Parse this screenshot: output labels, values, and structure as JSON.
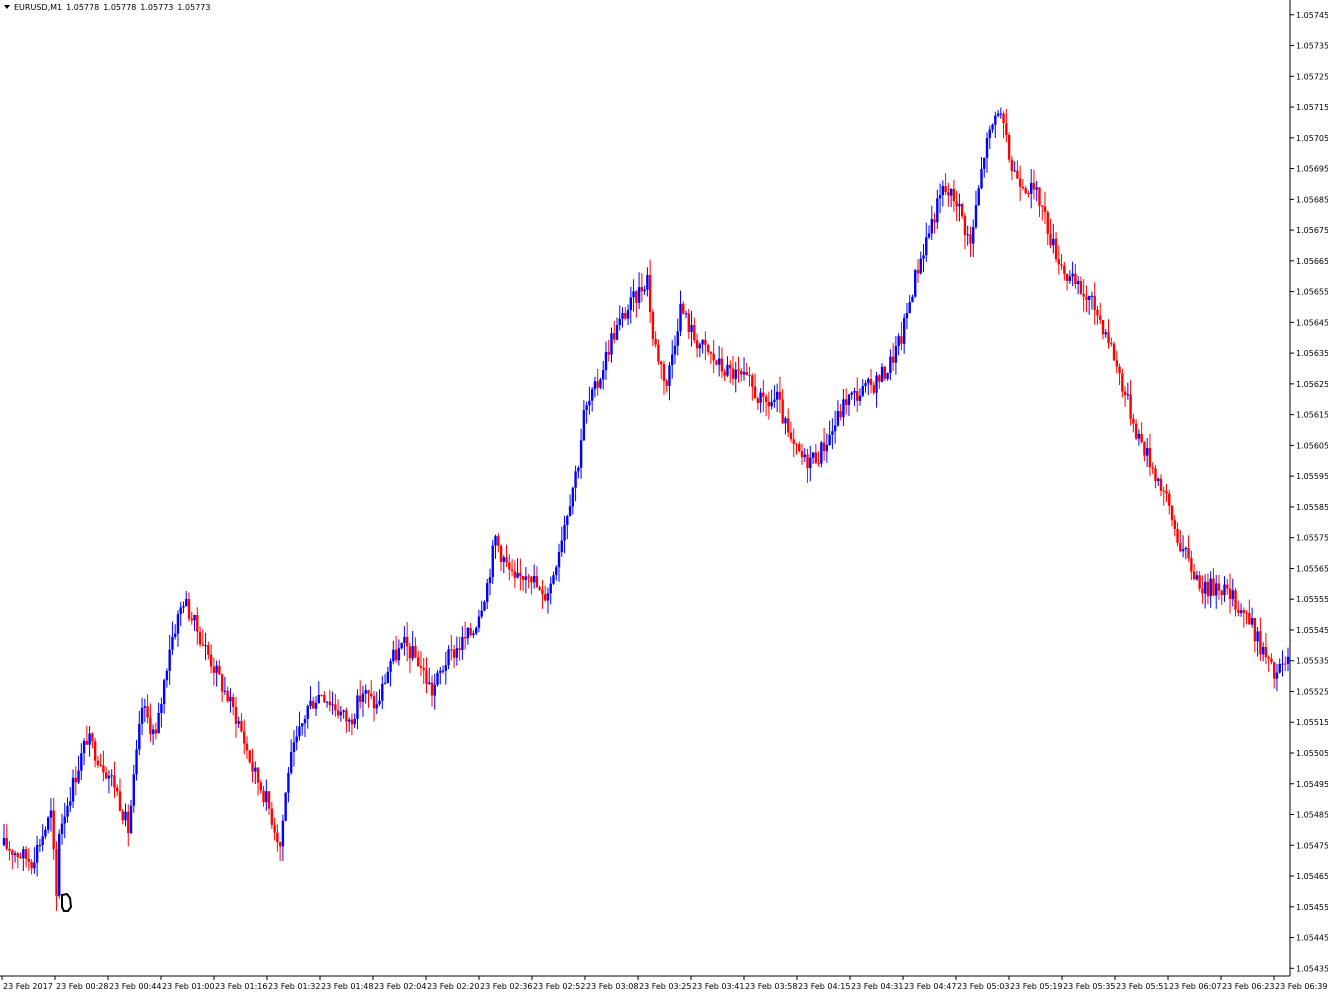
{
  "header": {
    "symbol": "EURUSD,M1",
    "open": "1.05778",
    "high": "1.05778",
    "low": "1.05773",
    "close": "1.05773"
  },
  "colors": {
    "bull": "#0000ff",
    "bear": "#ff0000",
    "axis": "#000000",
    "background": "#ffffff"
  },
  "chart_data": {
    "type": "ohlc_bar",
    "y_axis_labels": [
      "1.05745",
      "1.05735",
      "1.05725",
      "1.05715",
      "1.05705",
      "1.05695",
      "1.05685",
      "1.05675",
      "1.05665",
      "1.05655",
      "1.05645",
      "1.05635",
      "1.05625",
      "1.05615",
      "1.05605",
      "1.05595",
      "1.05585",
      "1.05575",
      "1.05565",
      "1.05555",
      "1.05545",
      "1.05535",
      "1.05525",
      "1.05515",
      "1.05505",
      "1.05495",
      "1.05485",
      "1.05475",
      "1.05465",
      "1.05455",
      "1.05445",
      "1.05435"
    ],
    "x_axis_labels": [
      "23 Feb 2017",
      "23 Feb 00:28",
      "23 Feb 00:44",
      "23 Feb 01:00",
      "23 Feb 01:16",
      "23 Feb 01:32",
      "23 Feb 01:48",
      "23 Feb 02:04",
      "23 Feb 02:20",
      "23 Feb 02:36",
      "23 Feb 02:52",
      "23 Feb 03:08",
      "23 Feb 03:25",
      "23 Feb 03:41",
      "23 Feb 03:58",
      "23 Feb 04:15",
      "23 Feb 04:31",
      "23 Feb 04:47",
      "23 Feb 05:03",
      "23 Feb 05:19",
      "23 Feb 05:35",
      "23 Feb 05:51",
      "23 Feb 06:07",
      "23 Feb 06:23",
      "23 Feb 06:39"
    ],
    "ylim": [
      1.054325,
      1.057485
    ],
    "path_points": [
      [
        0,
        1.05475
      ],
      [
        10,
        1.0547
      ],
      [
        17,
        1.05485
      ],
      [
        19,
        1.05458
      ],
      [
        20,
        1.0548
      ],
      [
        30,
        1.0551
      ],
      [
        40,
        1.05495
      ],
      [
        45,
        1.0548
      ],
      [
        50,
        1.0552
      ],
      [
        55,
        1.0551
      ],
      [
        60,
        1.0554
      ],
      [
        65,
        1.05555
      ],
      [
        70,
        1.05545
      ],
      [
        75,
        1.05535
      ],
      [
        80,
        1.05525
      ],
      [
        85,
        1.05515
      ],
      [
        90,
        1.055
      ],
      [
        95,
        1.0549
      ],
      [
        100,
        1.05475
      ],
      [
        103,
        1.055
      ],
      [
        110,
        1.0552
      ],
      [
        115,
        1.05525
      ],
      [
        120,
        1.0552
      ],
      [
        125,
        1.05515
      ],
      [
        130,
        1.05525
      ],
      [
        135,
        1.0552
      ],
      [
        140,
        1.05535
      ],
      [
        145,
        1.0554
      ],
      [
        150,
        1.05535
      ],
      [
        155,
        1.05525
      ],
      [
        160,
        1.05535
      ],
      [
        165,
        1.0554
      ],
      [
        170,
        1.05545
      ],
      [
        175,
        1.0556
      ],
      [
        178,
        1.05575
      ],
      [
        180,
        1.0557
      ],
      [
        185,
        1.0556
      ],
      [
        190,
        1.05565
      ],
      [
        195,
        1.05555
      ],
      [
        198,
        1.0556
      ],
      [
        203,
        1.0558
      ],
      [
        208,
        1.056
      ],
      [
        210,
        1.05615
      ],
      [
        215,
        1.05625
      ],
      [
        220,
        1.0564
      ],
      [
        225,
        1.05648
      ],
      [
        230,
        1.05655
      ],
      [
        233,
        1.0566
      ],
      [
        235,
        1.0564
      ],
      [
        240,
        1.05625
      ],
      [
        245,
        1.0565
      ],
      [
        250,
        1.0564
      ],
      [
        255,
        1.05635
      ],
      [
        260,
        1.0563
      ],
      [
        265,
        1.05628
      ],
      [
        270,
        1.05625
      ],
      [
        275,
        1.05618
      ],
      [
        280,
        1.0562
      ],
      [
        285,
        1.05605
      ],
      [
        290,
        1.056
      ],
      [
        295,
        1.05602
      ],
      [
        300,
        1.0561
      ],
      [
        305,
        1.0562
      ],
      [
        310,
        1.05622
      ],
      [
        315,
        1.05625
      ],
      [
        320,
        1.0563
      ],
      [
        325,
        1.0564
      ],
      [
        330,
        1.0566
      ],
      [
        335,
        1.05675
      ],
      [
        340,
        1.05688
      ],
      [
        345,
        1.05685
      ],
      [
        350,
        1.0567
      ],
      [
        355,
        1.057
      ],
      [
        360,
        1.05715
      ],
      [
        365,
        1.05695
      ],
      [
        370,
        1.0569
      ],
      [
        375,
        1.05685
      ],
      [
        380,
        1.0567
      ],
      [
        385,
        1.0566
      ],
      [
        390,
        1.05655
      ],
      [
        395,
        1.0565
      ],
      [
        400,
        1.0564
      ],
      [
        405,
        1.05625
      ],
      [
        410,
        1.0561
      ],
      [
        415,
        1.056
      ],
      [
        420,
        1.0559
      ],
      [
        425,
        1.05575
      ],
      [
        430,
        1.05565
      ],
      [
        435,
        1.05558
      ],
      [
        440,
        1.0556
      ],
      [
        445,
        1.05555
      ],
      [
        450,
        1.0555
      ],
      [
        455,
        1.0554
      ],
      [
        460,
        1.0553
      ],
      [
        465,
        1.05535
      ]
    ],
    "last_index": 465
  }
}
